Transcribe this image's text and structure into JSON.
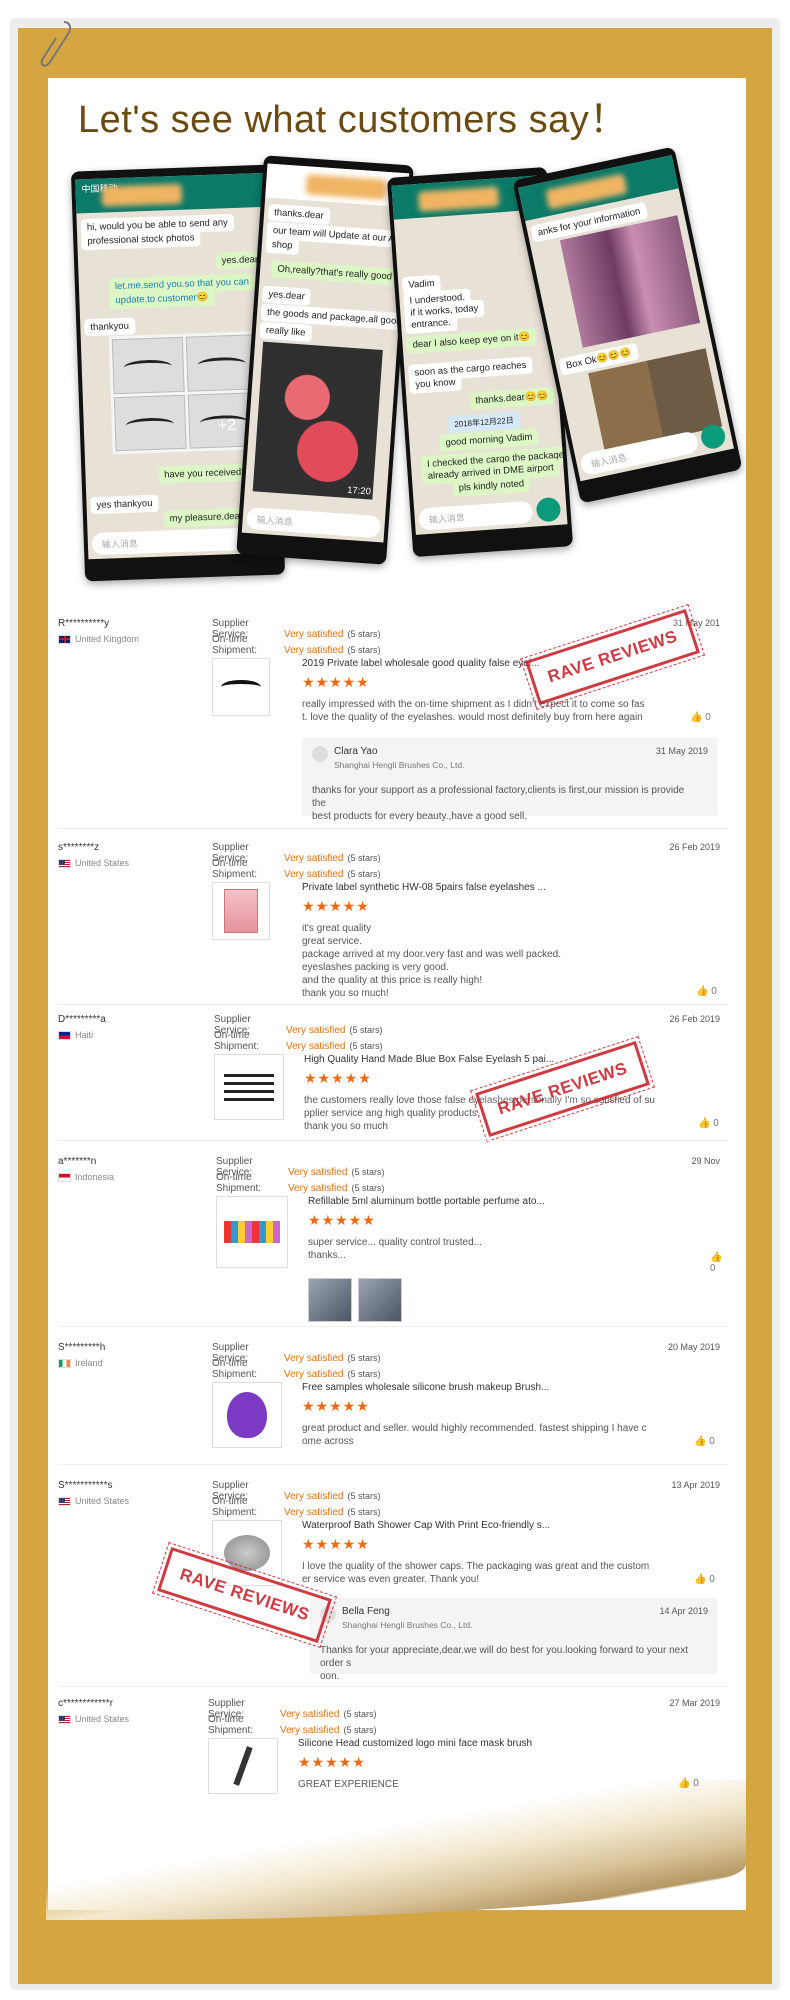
{
  "headline": "Let's see what customers say！",
  "chats": {
    "phone1": {
      "status": "中国移动",
      "msgs": [
        "hi, would you be able to send any",
        "professional stock photos",
        "yes.dear",
        "let.me.send you.so that you can",
        "update.to customer😊",
        "thankyou",
        "+2",
        "have you received?dear",
        "yes thankyou",
        "my pleasure.dear"
      ],
      "input": "输入消息"
    },
    "phone2": {
      "msgs": [
        "thanks.dear",
        "our team will Update at our Amazon",
        "shop",
        "Oh,really?that's really good",
        "yes.dear",
        "the goods and package,all good",
        "really like"
      ],
      "time": "17:20",
      "input": "输入消息"
    },
    "phone3": {
      "msgs": [
        "Vadim",
        "I understood.",
        "if it works, today",
        "entrance.",
        "dear I also keep eye on it😊",
        "soon as the cargo reaches",
        "you know",
        "thanks.dear😊😊",
        "2018年12月22日",
        "good morning Vadim",
        "I checked the cargo the package",
        "already arrived in DME airport",
        "pls kindly noted"
      ],
      "input": "输入消息"
    },
    "phone4": {
      "msgs": [
        "anks for your information",
        "Box Ok😊😊😊"
      ],
      "input": "输入消息"
    }
  },
  "labels": {
    "supplier": "Supplier Service:",
    "ontime": "On-time Shipment:",
    "very": "Very satisfied",
    "stars5": "(5 stars)",
    "stamp": "RAVE REVIEWS"
  },
  "reviews": [
    {
      "name": "R**********y",
      "country": "United Kingdom",
      "date": "31 May 201",
      "product": "2019 Private label wholesale good quality false eyel...",
      "stars": "★★★★★",
      "text1": "really impressed with the on-time shipment as I didn't expect it to come so fas",
      "text2": "t. love the quality of the eyelashes. would most definitely buy from here again",
      "likes": "0",
      "reply": {
        "name": "Clara Yao",
        "company": "Shanghai Hengli Brushes Co., Ltd.",
        "date": "31 May 2019",
        "text1": "thanks for  your support as a professional factory,clients is first,our mission is provide the",
        "text2": "best products for every beauty.,have a good sell."
      }
    },
    {
      "name": "s********z",
      "country": "United States",
      "date": "26 Feb 2019",
      "product": "Private label synthetic HW-08 5pairs false eyelashes ...",
      "stars": "★★★★★",
      "lines": [
        "it's great quality",
        "great service.",
        "package arrived at my door.very fast and was well packed.",
        "eyeslashes packing is very good.",
        "and the quality at this price is really high!",
        "thank you so much!"
      ],
      "likes": "0"
    },
    {
      "name": "D*********a",
      "country": "Haiti",
      "date": "26 Feb 2019",
      "product": "High Quality Hand Made Blue Box False Eyelash 5 pai...",
      "stars": "★★★★★",
      "text1": "the customers really love those false eyelashes,personally I'm so satisfied of su",
      "text2": "pplier service ang high quality products",
      "text3": "thank you so much",
      "likes": "0"
    },
    {
      "name": "a*******n",
      "country": "Indonesia",
      "date": "29 Nov",
      "product": "Refillable 5ml aluminum bottle portable perfume ato...",
      "stars": "★★★★★",
      "text1": "super service...  quality control trusted...",
      "text2": "thanks...",
      "likes": "0"
    },
    {
      "name": "S*********h",
      "country": "Ireland",
      "date": "20 May 2019",
      "product": "Free samples wholesale silicone brush makeup Brush...",
      "stars": "★★★★★",
      "text1": "great product and seller. would highly recommended. fastest shipping I have c",
      "text2": "ome across",
      "likes": "0"
    },
    {
      "name": "S***********s",
      "country": "United States",
      "date": "13 Apr 2019",
      "product": "Waterproof Bath Shower Cap With Print Eco-friendly s...",
      "stars": "★★★★★",
      "text1": "I love the quality of the shower caps. The packaging was great and the custom",
      "text2": "er service was even greater. Thank you!",
      "likes": "0",
      "reply": {
        "name": "Bella Feng",
        "company": "Shanghai Hengli Brushes Co., Ltd.",
        "date": "14 Apr 2019",
        "text1": "Thanks for your appreciate,dear.we will do best for you.looking forward to your next order s",
        "text2": "oon."
      }
    },
    {
      "name": "c************r",
      "country": "United States",
      "date": "27 Mar 2019",
      "product": "Silicone Head customized logo mini face mask brush",
      "stars": "★★★★★",
      "text1": "GREAT EXPERIENCE",
      "likes": "0"
    }
  ]
}
